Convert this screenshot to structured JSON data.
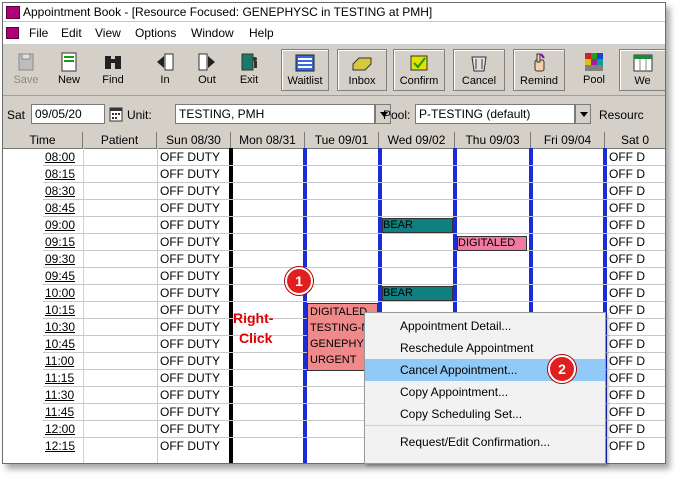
{
  "window": {
    "title": "Appointment Book - [Resource Focused:  GENEPHYSC in TESTING at PMH]"
  },
  "menu": [
    "File",
    "Edit",
    "View",
    "Options",
    "Window",
    "Help"
  ],
  "toolbar": {
    "save": "Save",
    "new": "New",
    "find": "Find",
    "in": "In",
    "out": "Out",
    "exit": "Exit",
    "waitlist": "Waitlist",
    "inbox": "Inbox",
    "confirm": "Confirm",
    "cancel": "Cancel",
    "remind": "Remind",
    "pool": "Pool",
    "week": "We"
  },
  "filters": {
    "day": "Sat",
    "date": "09/05/20",
    "unit_label": "Unit:",
    "unit": "TESTING, PMH",
    "pool_label": "Pool:",
    "pool": "P-TESTING (default)",
    "resource_label": "Resourc"
  },
  "grid": {
    "headers": [
      "Time",
      "Patient",
      "Sun 08/30",
      "Mon 08/31",
      "Tue 09/01",
      "Wed 09/02",
      "Thu 09/03",
      "Fri 09/04",
      "Sat 0"
    ],
    "times": [
      "08:00",
      "08:15",
      "08:30",
      "08:45",
      "09:00",
      "09:15",
      "09:30",
      "09:45",
      "10:00",
      "10:15",
      "10:30",
      "10:45",
      "11:00",
      "11:15",
      "11:30",
      "11:45",
      "12:00",
      "12:15"
    ],
    "off_duty": "OFF DUTY",
    "off_duty_sat": "OFF D"
  },
  "appointments": {
    "wed_0900": "BEAR",
    "thu_0915": "DIGITALED",
    "wed_1000": "BEAR",
    "tue_1015": [
      "DIGITALED",
      "TESTING-N",
      "GENEPHY",
      "URGENT"
    ]
  },
  "annotation": {
    "right": "Right-",
    "click": "Click",
    "step1": "1",
    "step2": "2"
  },
  "context_menu": [
    "Appointment Detail...",
    "Reschedule Appointment",
    "Cancel Appointment...",
    "Copy Appointment...",
    "Copy Scheduling Set...",
    "Request/Edit Confirmation..."
  ],
  "colors": {
    "teal": "#0f7f7f",
    "pink": "#f07aa0",
    "salmon": "#f08a8a",
    "blue_line": "#1a2cd6",
    "menu_highlight": "#91c9f7"
  }
}
